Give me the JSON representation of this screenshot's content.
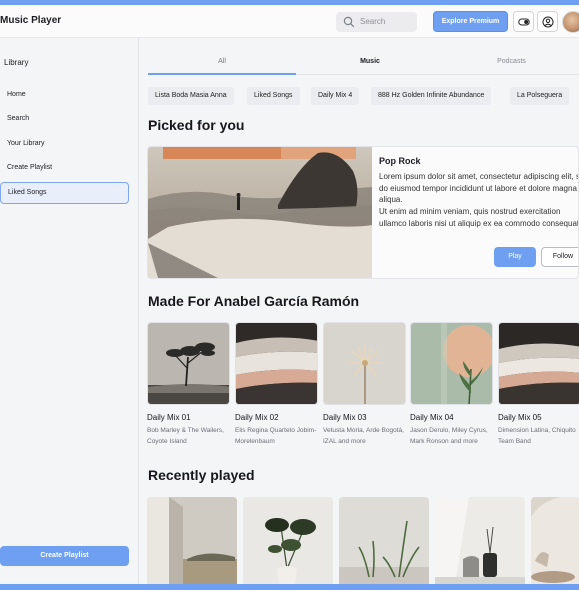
{
  "header": {
    "app_title": "Music Player",
    "search_placeholder": "Search",
    "premium_label": "Explore Premium"
  },
  "sidebar": {
    "title": "Library",
    "items": [
      {
        "label": "Home",
        "active": false
      },
      {
        "label": "Search",
        "active": false
      },
      {
        "label": "Your Library",
        "active": false
      },
      {
        "label": "Create Playlist",
        "active": false
      },
      {
        "label": "Liked Songs",
        "active": true
      }
    ],
    "create_button": "Create Playlist"
  },
  "tabs": [
    {
      "label": "All",
      "selected": true
    },
    {
      "label": "Music",
      "selected": false
    },
    {
      "label": "Podcasts",
      "selected": false
    }
  ],
  "chips": [
    "Lista Boda Masia Anna",
    "Liked Songs",
    "Daily Mix 4",
    "888 Hz Golden Infinite Abundance",
    "La Polseguera"
  ],
  "picked": {
    "heading": "Picked for you",
    "title": "Pop Rock",
    "description_1": "Lorem ipsum dolor sit amet, consectetur adipiscing elit, sed do eiusmod tempor incididunt ut labore et dolore magna aliqua.",
    "description_2": "Ut enim ad minim veniam, quis nostrud exercitation ullamco laboris nisi ut aliquip ex ea commodo consequat.",
    "play_label": "Play",
    "follow_label": "Follow"
  },
  "made_for": {
    "heading": "Made For Anabel García Ramón",
    "mixes": [
      {
        "title": "Daily Mix 01",
        "subtitle": "Bob Marley & The Wailers, Coyote Island"
      },
      {
        "title": "Daily Mix 02",
        "subtitle": "Elis Regina Quarteto Jobim-Morelenbaum"
      },
      {
        "title": "Daily Mix 03",
        "subtitle": "Vetusta Morla, Arde Bogotá, IZAL and more"
      },
      {
        "title": "Daily Mix 04",
        "subtitle": "Jason Derulo, Miley Cyrus, Mark Ronson and more"
      },
      {
        "title": "Daily Mix 05",
        "subtitle": "Dimension Latina, Chiquito Team Band"
      }
    ]
  },
  "recent": {
    "heading": "Recently played"
  },
  "colors": {
    "accent": "#6f9ff0",
    "background": "#f4f5f7"
  }
}
